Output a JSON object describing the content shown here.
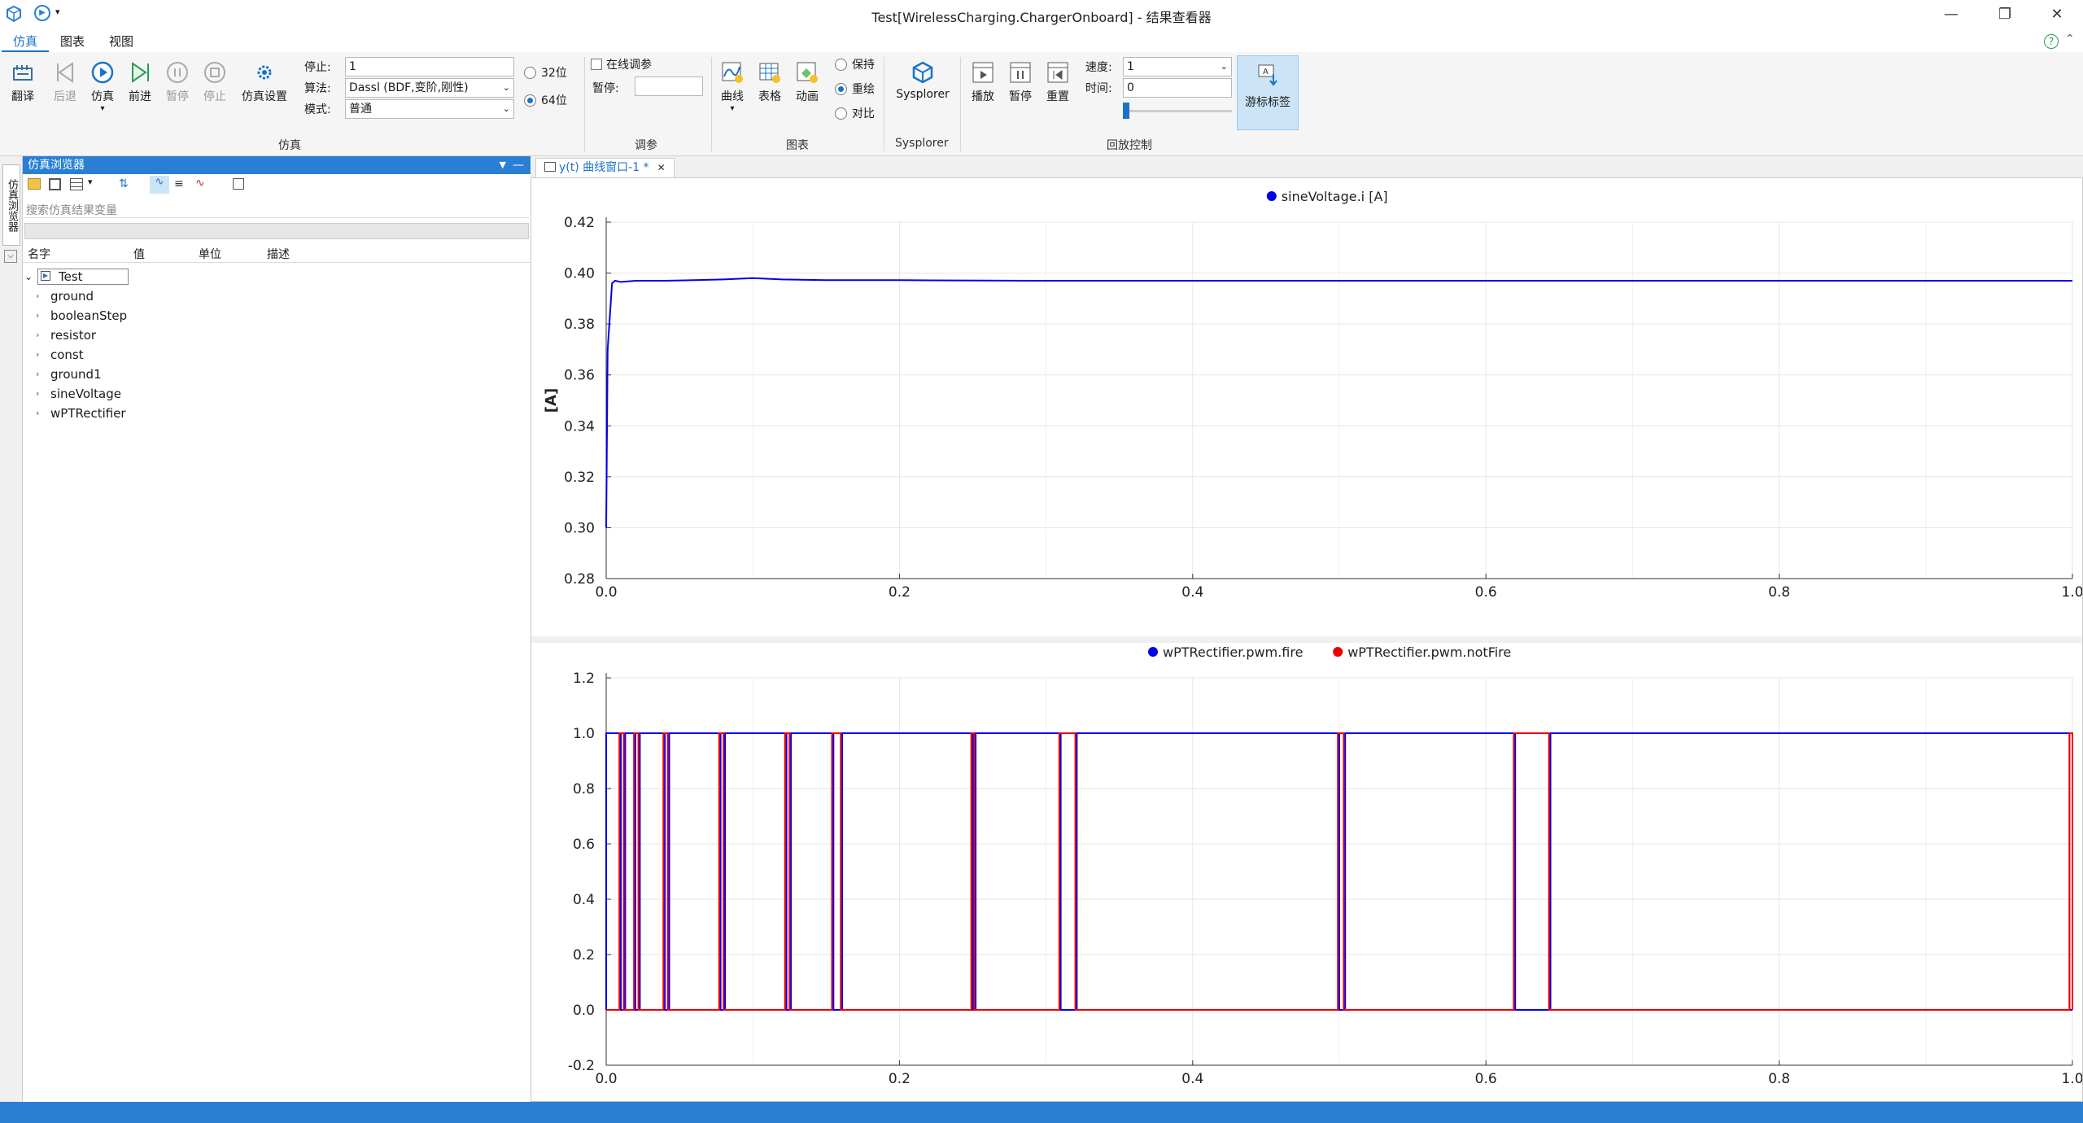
{
  "window": {
    "title": "Test[WirelessCharging.ChargerOnboard] - 结果查看器"
  },
  "menu": {
    "tabs": [
      "仿真",
      "图表",
      "视图"
    ]
  },
  "ribbon": {
    "translate": "翻译",
    "back": "后退",
    "simulate": "仿真",
    "forward": "前进",
    "pause": "暂停",
    "stop": "停止",
    "settings": "仿真设置",
    "stop_label": "停止:",
    "stop_value": "1",
    "algo_label": "算法:",
    "algo_value": "Dassl (BDF,变阶,刚性)",
    "mode_label": "模式:",
    "mode_value": "普通",
    "bit32": "32位",
    "bit64": "64位",
    "online_tune": "在线调参",
    "pause_label": "暂停:",
    "curve": "曲线",
    "table": "表格",
    "animation": "动画",
    "keep": "保持",
    "redraw": "重绘",
    "compare": "对比",
    "sysplorer": "Sysplorer",
    "play": "播放",
    "pause2": "暂停",
    "reset": "重置",
    "speed_label": "速度:",
    "speed_value": "1",
    "time_label": "时间:",
    "time_value": "0",
    "cursor_label": "游标标签",
    "groups": {
      "sim": "仿真",
      "tune": "调参",
      "chart": "图表",
      "sysplorer": "Sysplorer",
      "playback": "回放控制"
    }
  },
  "sidetab": {
    "label": "仿真浏览器"
  },
  "browser": {
    "title": "仿真浏览器",
    "search_placeholder": "搜索仿真结果变量",
    "columns": [
      "名字",
      "值",
      "单位",
      "描述"
    ],
    "root": "Test",
    "items": [
      "ground",
      "booleanStep",
      "resistor",
      "const",
      "ground1",
      "sineVoltage",
      "wPTRectifier"
    ]
  },
  "doc_tab": {
    "label": "y(t) 曲线窗口-1 *"
  },
  "colors": {
    "blue": "#0000ee",
    "red": "#ee0000",
    "accent": "#2a7fd4"
  },
  "chart_data": [
    {
      "type": "line",
      "series": [
        {
          "name": "sineVoltage.i [A]",
          "color": "#0000ee",
          "x": [
            0,
            0.001,
            0.004,
            0.006,
            0.01,
            0.02,
            0.04,
            0.06,
            0.08,
            0.1,
            0.12,
            0.15,
            0.2,
            0.3,
            0.4,
            0.5,
            0.6,
            0.7,
            0.8,
            0.9,
            1.0
          ],
          "y": [
            0.3,
            0.37,
            0.396,
            0.397,
            0.3965,
            0.397,
            0.397,
            0.3972,
            0.3975,
            0.398,
            0.3975,
            0.3972,
            0.3972,
            0.397,
            0.397,
            0.397,
            0.397,
            0.397,
            0.397,
            0.397,
            0.397
          ]
        }
      ],
      "ylabel": "[A]",
      "xlim": [
        0,
        1
      ],
      "ylim": [
        0.28,
        0.42
      ],
      "xticks": [
        "0.0",
        "0.2",
        "0.4",
        "0.6",
        "0.8",
        "1.0"
      ],
      "yticks": [
        "0.28",
        "0.30",
        "0.32",
        "0.34",
        "0.36",
        "0.38",
        "0.40",
        "0.42"
      ],
      "grid": true,
      "legend": "top"
    },
    {
      "type": "line",
      "series": [
        {
          "name": "wPTRectifier.pwm.fire",
          "color": "#0000ee",
          "high_intervals": [
            [
              0,
              0.01
            ],
            [
              0.013,
              0.02
            ],
            [
              0.023,
              0.04
            ],
            [
              0.043,
              0.078
            ],
            [
              0.081,
              0.123
            ],
            [
              0.126,
              0.155
            ],
            [
              0.161,
              0.25
            ],
            [
              0.252,
              0.31
            ],
            [
              0.321,
              0.5
            ],
            [
              0.504,
              0.62
            ],
            [
              0.644,
              0.998
            ]
          ]
        },
        {
          "name": "wPTRectifier.pwm.notFire",
          "color": "#ee0000",
          "high_intervals": [
            [
              0.009,
              0.012
            ],
            [
              0.019,
              0.022
            ],
            [
              0.039,
              0.042
            ],
            [
              0.077,
              0.08
            ],
            [
              0.122,
              0.125
            ],
            [
              0.154,
              0.16
            ],
            [
              0.249,
              0.251
            ],
            [
              0.309,
              0.32
            ],
            [
              0.499,
              0.503
            ],
            [
              0.619,
              0.643
            ],
            [
              0.998,
              1.0
            ]
          ]
        }
      ],
      "xlim": [
        0,
        1
      ],
      "ylim": [
        -0.2,
        1.2
      ],
      "xticks": [
        "0.0",
        "0.2",
        "0.4",
        "0.6",
        "0.8",
        "1.0"
      ],
      "yticks": [
        "-0.2",
        "0.0",
        "0.2",
        "0.4",
        "0.6",
        "0.8",
        "1.0",
        "1.2"
      ],
      "grid": true,
      "legend": "top"
    }
  ]
}
